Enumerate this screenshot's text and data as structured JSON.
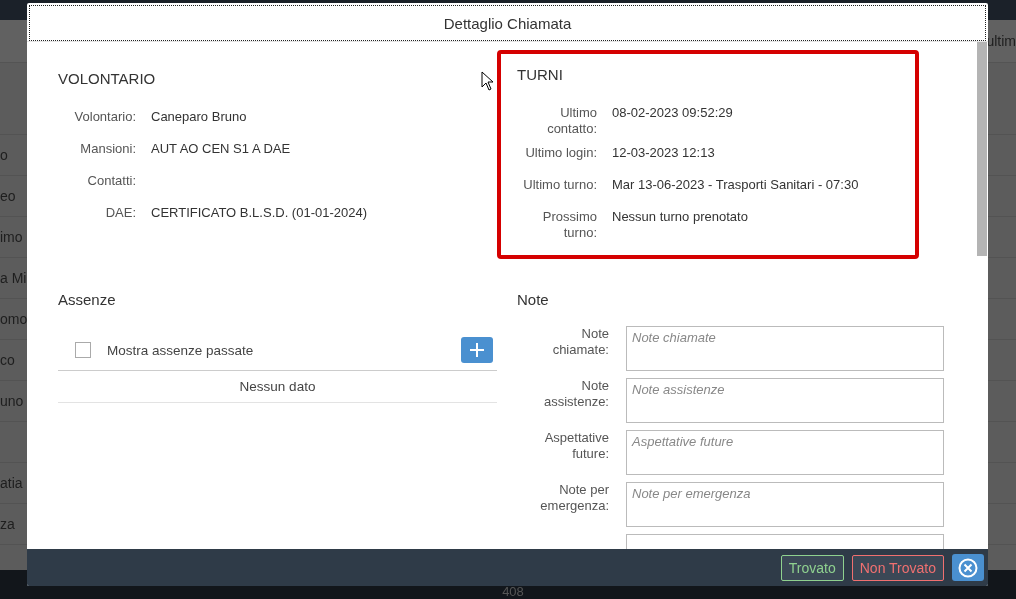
{
  "background": {
    "header_fragment": "ultim",
    "rows": [
      {},
      {
        "fragment": "o"
      },
      {
        "fragment": "eo"
      },
      {
        "fragment": "imo"
      },
      {
        "fragment": "a Mi"
      },
      {
        "fragment": "omo"
      },
      {
        "fragment": "co"
      },
      {
        "fragment": "uno"
      },
      {},
      {
        "fragment": "atia"
      },
      {
        "fragment": "za"
      },
      {}
    ],
    "footer_number": "408"
  },
  "dialog": {
    "title": "Dettaglio Chiamata",
    "volontario": {
      "heading": "VOLONTARIO",
      "fields": [
        {
          "label": "Volontario:",
          "value": "Caneparo Bruno"
        },
        {
          "label": "Mansioni:",
          "value": "AUT AO CEN S1 A DAE"
        },
        {
          "label": "Contatti:"
        },
        {
          "label": "DAE:",
          "value": "CERTIFICATO B.L.S.D. (01-01-2024)"
        }
      ]
    },
    "turni": {
      "heading": "TURNI",
      "highlighted": true,
      "fields": [
        {
          "label": "Ultimo contatto:",
          "value": "08-02-2023 09:52:29"
        },
        {
          "label": "Ultimo login:",
          "value": "12-03-2023 12:13"
        },
        {
          "label": "Ultimo turno:",
          "value": "Mar 13-06-2023 - Trasporti Sanitari - 07:30"
        },
        {
          "label": "Prossimo turno:",
          "value": "Nessun turno prenotato"
        }
      ]
    },
    "assenze": {
      "heading": "Assenze",
      "show_past": {
        "label": "Mostra assenze passate",
        "checked": false
      },
      "empty_text": "Nessun dato"
    },
    "note": {
      "heading": "Note",
      "fields": [
        {
          "label": "Note chiamate:",
          "placeholder": "Note chiamate"
        },
        {
          "label": "Note assistenze:",
          "placeholder": "Note assistenze"
        },
        {
          "label": "Aspettative future:",
          "placeholder": "Aspettative future"
        },
        {
          "label": "Note per emergenza:",
          "placeholder": "Note per emergenza"
        }
      ],
      "more_below": true
    },
    "buttons": [
      {
        "label": "Trovato",
        "kind": "found"
      },
      {
        "label": "Non Trovato",
        "kind": "not_found"
      }
    ]
  }
}
